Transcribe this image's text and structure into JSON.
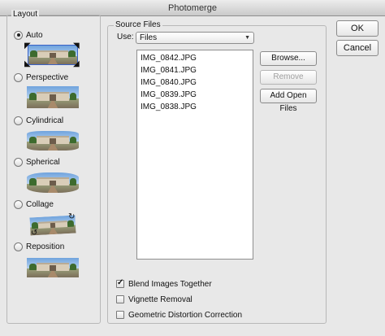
{
  "window": {
    "title": "Photomerge"
  },
  "layout": {
    "title": "Layout",
    "options": [
      {
        "label": "Auto",
        "selected": true
      },
      {
        "label": "Perspective",
        "selected": false
      },
      {
        "label": "Cylindrical",
        "selected": false
      },
      {
        "label": "Spherical",
        "selected": false
      },
      {
        "label": "Collage",
        "selected": false
      },
      {
        "label": "Reposition",
        "selected": false
      }
    ]
  },
  "source": {
    "title": "Source Files",
    "use_label": "Use:",
    "use_value": "Files",
    "files": [
      "IMG_0842.JPG",
      "IMG_0841.JPG",
      "IMG_0840.JPG",
      "IMG_0839.JPG",
      "IMG_0838.JPG"
    ],
    "browse": "Browse...",
    "remove": "Remove",
    "add_open": "Add Open Files"
  },
  "checks": {
    "blend": {
      "label": "Blend Images Together",
      "checked": true
    },
    "vignette": {
      "label": "Vignette Removal",
      "checked": false
    },
    "distortion": {
      "label": "Geometric Distortion Correction",
      "checked": false
    }
  },
  "actions": {
    "ok": "OK",
    "cancel": "Cancel"
  }
}
